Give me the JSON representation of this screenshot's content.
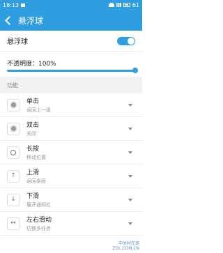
{
  "statusbar": {
    "time": "18:13",
    "battery": "61"
  },
  "titlebar": {
    "title": "悬浮球"
  },
  "float_ball": {
    "label": "悬浮球",
    "enabled": true
  },
  "opacity": {
    "label": "不透明度：100%",
    "value_percent": 100
  },
  "functions": {
    "section_label": "功能",
    "items": [
      {
        "title": "单击",
        "subtitle": "返回上一级",
        "icon": "filled-dot-icon"
      },
      {
        "title": "双击",
        "subtitle": "关闭",
        "icon": "filled-dot-icon"
      },
      {
        "title": "长按",
        "subtitle": "移动位置",
        "icon": "ring-icon"
      },
      {
        "title": "上滑",
        "subtitle": "返回桌面",
        "icon": "swipe-up-icon"
      },
      {
        "title": "下滑",
        "subtitle": "展开通知栏",
        "icon": "swipe-down-icon"
      },
      {
        "title": "左右滑动",
        "subtitle": "切换多任务",
        "icon": "swipe-horizontal-icon"
      }
    ]
  },
  "watermark": {
    "line1": "中关村在线",
    "line2": "ZOL.COM.CN"
  }
}
